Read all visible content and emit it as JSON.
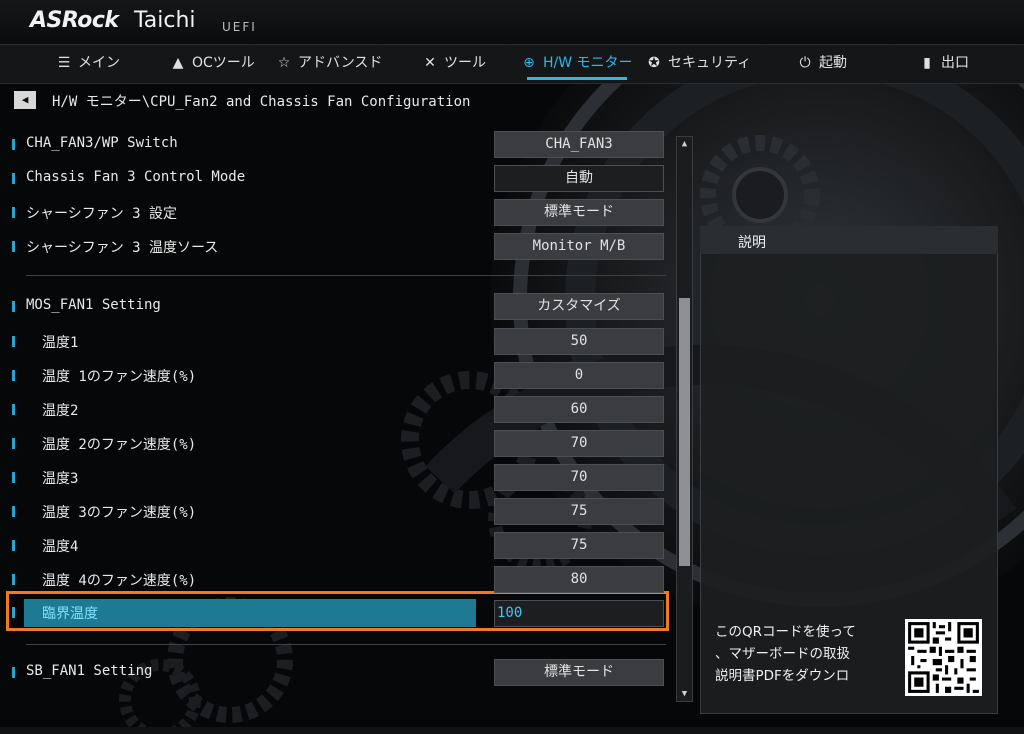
{
  "brand": {
    "name": "ASRock",
    "model": "Taichi",
    "firmware": "UEFI"
  },
  "nav": {
    "tabs": [
      {
        "label": "メイン",
        "icon": "list-icon",
        "active": false
      },
      {
        "label": "OCツール",
        "icon": "rocket-icon",
        "active": false
      },
      {
        "label": "アドバンスド",
        "icon": "star-icon",
        "active": false
      },
      {
        "label": "ツール",
        "icon": "tools-icon",
        "active": false
      },
      {
        "label": "H/W モニター",
        "icon": "crosshair-icon",
        "active": true
      },
      {
        "label": "セキュリティ",
        "icon": "shield-icon",
        "active": false
      },
      {
        "label": "起動",
        "icon": "power-icon",
        "active": false
      },
      {
        "label": "出口",
        "icon": "exit-door-icon",
        "active": false
      }
    ]
  },
  "breadcrumb": {
    "path": "H/W モニター\\CPU_Fan2 and Chassis Fan Configuration"
  },
  "settings": [
    {
      "label": "CHA_FAN3/WP Switch",
      "value": "CHA_FAN3"
    },
    {
      "label": "Chassis Fan 3 Control Mode",
      "value": "自動"
    },
    {
      "label": "シャーシファン 3 設定",
      "value": "標準モード"
    },
    {
      "label": "シャーシファン 3 温度ソース",
      "value": "Monitor M/B"
    },
    {
      "label": "MOS_FAN1 Setting",
      "value": "カスタマイズ"
    },
    {
      "label": "温度1",
      "value": "50"
    },
    {
      "label": "温度 1のファン速度(%)",
      "value": "0"
    },
    {
      "label": "温度2",
      "value": "60"
    },
    {
      "label": "温度 2のファン速度(%)",
      "value": "70"
    },
    {
      "label": "温度3",
      "value": "70"
    },
    {
      "label": "温度 3のファン速度(%)",
      "value": "75"
    },
    {
      "label": "温度4",
      "value": "75"
    },
    {
      "label": "温度 4のファン速度(%)",
      "value": "80"
    },
    {
      "label": "臨界温度",
      "value": "100",
      "selected": true
    },
    {
      "label": "SB_FAN1 Setting",
      "value": "標準モード"
    }
  ],
  "description": {
    "title": "説明",
    "qr_text": [
      "このQRコードを使って",
      "、マザーボードの取扱",
      "説明書PDFをダウンロ"
    ]
  },
  "colors": {
    "accent": "#2fb7e6",
    "selection": "#1d7a92",
    "highlight_outline": "#ef7a22"
  },
  "scroll": {
    "position_fraction": 0.55,
    "visible_fraction": 0.5
  }
}
